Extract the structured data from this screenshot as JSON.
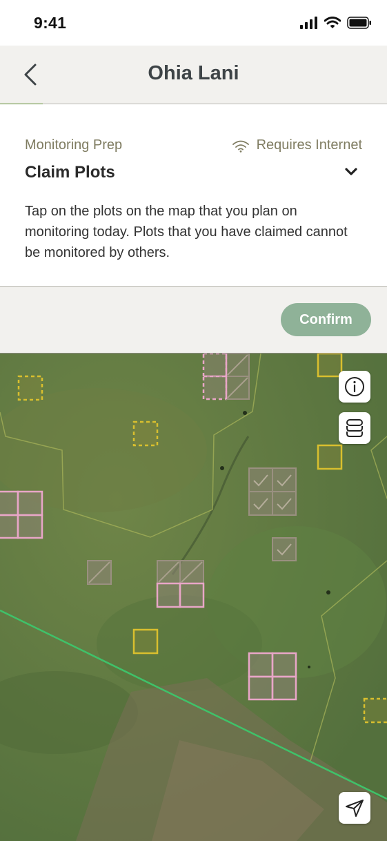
{
  "status_bar": {
    "time": "9:41"
  },
  "header": {
    "title": "Ohia Lani"
  },
  "progress": {
    "fraction": 0.11
  },
  "panel": {
    "step_label": "Monitoring Prep",
    "requires_internet": "Requires Internet",
    "step_title": "Claim Plots",
    "description": "Tap on the plots on the map that you plan on monitoring today. Plots that you have claimed cannot be monitored by others."
  },
  "actions": {
    "confirm_label": "Confirm"
  },
  "colors": {
    "accent_green": "#5b8a2c",
    "confirm_bg": "#8fb298",
    "plot_claimed": "#e9a6c8",
    "plot_available": "#d9bf2e",
    "plot_monitored": "#8c8474",
    "transect_line": "#3fc26a"
  },
  "icons": {
    "back": "chevron-left-icon",
    "wifi": "wifi-icon",
    "expand": "chevron-down-icon",
    "info": "info-icon",
    "layers": "layers-icon",
    "locate": "navigation-arrow-icon"
  }
}
